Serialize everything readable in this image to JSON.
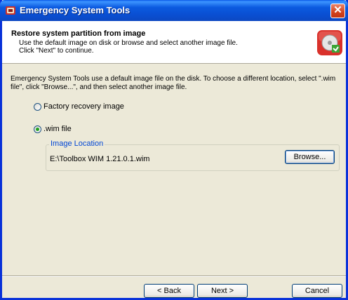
{
  "window": {
    "title": "Emergency System Tools",
    "close_symbol": "✕"
  },
  "header": {
    "title": "Restore system partition from image",
    "description": "Use the default image on disk or browse and select another image file.\nClick \"Next\" to continue.",
    "icon": "disk-restore-icon"
  },
  "content": {
    "instructions": "Emergency System Tools use a default image file on the disk. To choose a different location, select \".wim file\", click \"Browse...\", and then select another image file."
  },
  "options": [
    {
      "label": "Factory recovery image",
      "checked": false
    },
    {
      "label": ".wim file",
      "checked": true
    }
  ],
  "image_location": {
    "group_label": "Image Location",
    "path": "E:\\Toolbox WIM 1.21.0.1.wim",
    "browse_label": "Browse..."
  },
  "footer": {
    "back_label": "Back",
    "back_label_prefix": "< ",
    "next_label": "Next",
    "next_label_suffix": " >",
    "cancel_label": "Cancel"
  },
  "colors": {
    "title_bar": "#0a4fd2",
    "dialog_bg": "#ece9d8",
    "group_label": "#0046d5",
    "radio_dot": "#21a121"
  }
}
